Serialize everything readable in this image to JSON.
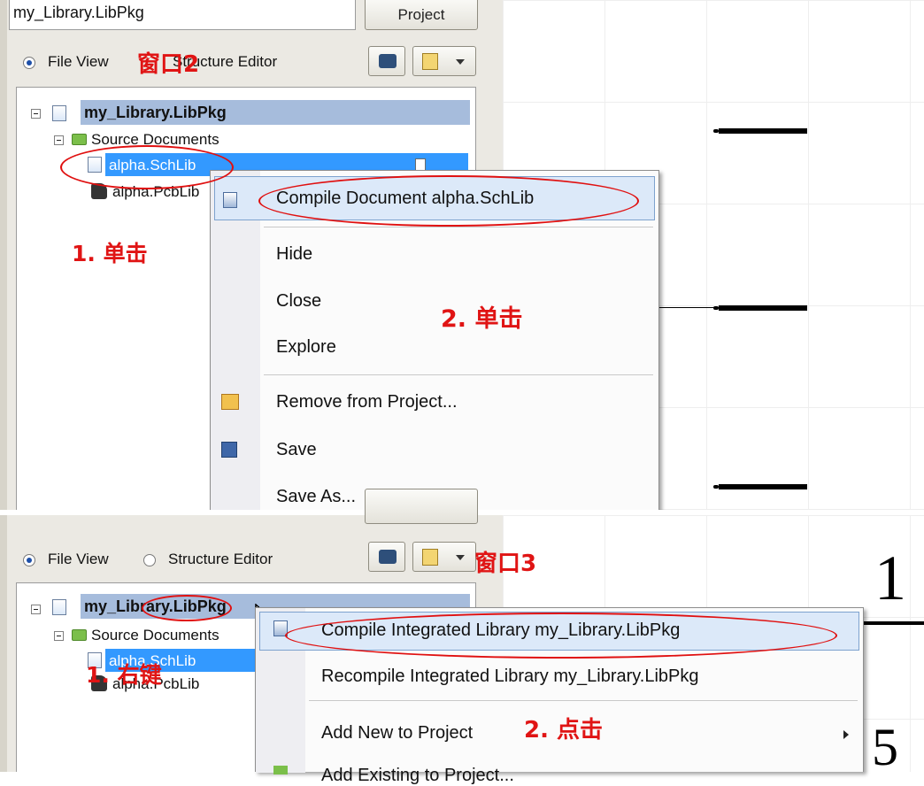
{
  "top": {
    "project_field_value": "my_Library.LibPkg",
    "project_button": "Project",
    "radio_file_view": "File View",
    "radio_structure_editor": "Structure Editor",
    "tree": {
      "root": "my_Library.LibPkg",
      "folder": "Source Documents",
      "doc1": "alpha.SchLib",
      "doc2": "alpha.PcbLib"
    },
    "menu": {
      "items": [
        "Compile Document alpha.SchLib",
        "Hide",
        "Close",
        "Explore",
        "Remove from Project...",
        "Save",
        "Save As..."
      ]
    },
    "annotations": {
      "window": "窗口2",
      "step1": "1. 单击",
      "step2": "2. 单击"
    }
  },
  "bottom": {
    "radio_file_view": "File View",
    "radio_structure_editor": "Structure Editor",
    "tree": {
      "root": "my_Library.LibPkg",
      "folder": "Source Documents",
      "doc1": "alpha.SchLib",
      "doc2": "alpha.PcbLib"
    },
    "menu": {
      "items": [
        "Compile Integrated Library my_Library.LibPkg",
        "Recompile Integrated Library my_Library.LibPkg",
        "Add New to Project",
        "Add Existing to Project..."
      ]
    },
    "annotations": {
      "window": "窗口3",
      "step1": "1. 右键",
      "step2": "2. 点击"
    },
    "schematic_labels": [
      "1",
      "5"
    ]
  },
  "colors": {
    "annotation_red": "#e01414",
    "selection_blue": "#3399ff",
    "root_highlight": "#a6bcdc",
    "menu_hover": "#dce9f9"
  }
}
